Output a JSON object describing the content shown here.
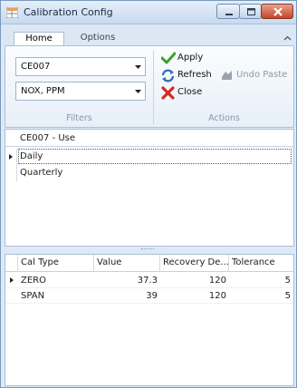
{
  "window": {
    "title": "Calibration Config"
  },
  "ribbon": {
    "tabs": [
      {
        "label": "Home"
      },
      {
        "label": "Options"
      }
    ],
    "filters": {
      "label": "Filters",
      "combo1": {
        "value": "CE007"
      },
      "combo2": {
        "value": "NOX, PPM"
      }
    },
    "actions": {
      "label": "Actions",
      "apply": "Apply",
      "refresh": "Refresh",
      "undo_paste": "Undo Paste",
      "close": "Close"
    }
  },
  "upper_grid": {
    "header": "CE007 - Use",
    "rows": [
      {
        "label": "Daily"
      },
      {
        "label": "Quarterly"
      }
    ]
  },
  "lower_grid": {
    "columns": [
      "Cal Type",
      "Value",
      "Recovery De...",
      "Tolerance"
    ],
    "rows": [
      {
        "cal_type": "ZERO",
        "value": "37.3",
        "recovery": "120",
        "tolerance": "5"
      },
      {
        "cal_type": "SPAN",
        "value": "39",
        "recovery": "120",
        "tolerance": "5"
      }
    ]
  },
  "colors": {
    "apply_check": "#3aa12a",
    "close_x": "#d42a1e",
    "title_close": "#c5432a"
  }
}
